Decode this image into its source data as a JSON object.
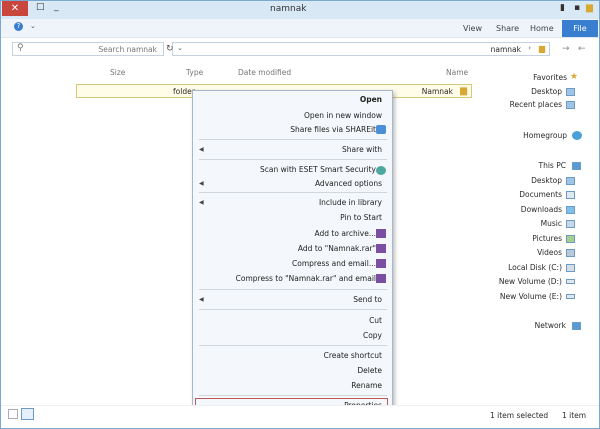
{
  "window": {
    "title": "namnak"
  },
  "ribbon": {
    "file": "File",
    "tabs": [
      "Home",
      "Share",
      "View"
    ]
  },
  "address": {
    "path": "namnak"
  },
  "search": {
    "placeholder": "Search namnak"
  },
  "columns": [
    "Name",
    "Date modified",
    "Type",
    "Size"
  ],
  "nav": {
    "favorites": {
      "label": "Favorites",
      "items": [
        "Desktop",
        "Recent places"
      ]
    },
    "homegroup": "Homegroup",
    "thispc": {
      "label": "This PC",
      "items": [
        "Desktop",
        "Documents",
        "Downloads",
        "Music",
        "Pictures",
        "Videos",
        "Local Disk (C:)",
        "New Volume (D:)",
        "New Volume (E:)"
      ]
    },
    "network": "Network"
  },
  "files": [
    {
      "name": "Namnak",
      "type": "folder"
    }
  ],
  "context_menu": [
    {
      "label": "Open",
      "bold": true
    },
    {
      "label": "Open in new window"
    },
    {
      "label": "Share files via SHAREit",
      "icon": "shareit-icon"
    },
    {
      "label": "Share with",
      "arrow": true
    },
    {
      "label": "Scan with ESET Smart Security",
      "icon": "eset-icon"
    },
    {
      "label": "Advanced options",
      "arrow": true
    },
    {
      "label": "Include in library",
      "arrow": true
    },
    {
      "label": "Pin to Start"
    },
    {
      "label": "Add to archive...",
      "icon": "winrar-icon"
    },
    {
      "label": "Add to \"Namnak.rar\"",
      "icon": "winrar-icon"
    },
    {
      "label": "Compress and email...",
      "icon": "winrar-icon"
    },
    {
      "label": "Compress to \"Namnak.rar\" and email",
      "icon": "winrar-icon"
    },
    {
      "label": "Send to",
      "arrow": true
    },
    {
      "label": "Cut"
    },
    {
      "label": "Copy"
    },
    {
      "label": "Create shortcut"
    },
    {
      "label": "Delete"
    },
    {
      "label": "Rename"
    },
    {
      "label": "Properties",
      "highlighted": true
    }
  ],
  "status": {
    "items": "1 item",
    "selected": "1 item selected"
  }
}
